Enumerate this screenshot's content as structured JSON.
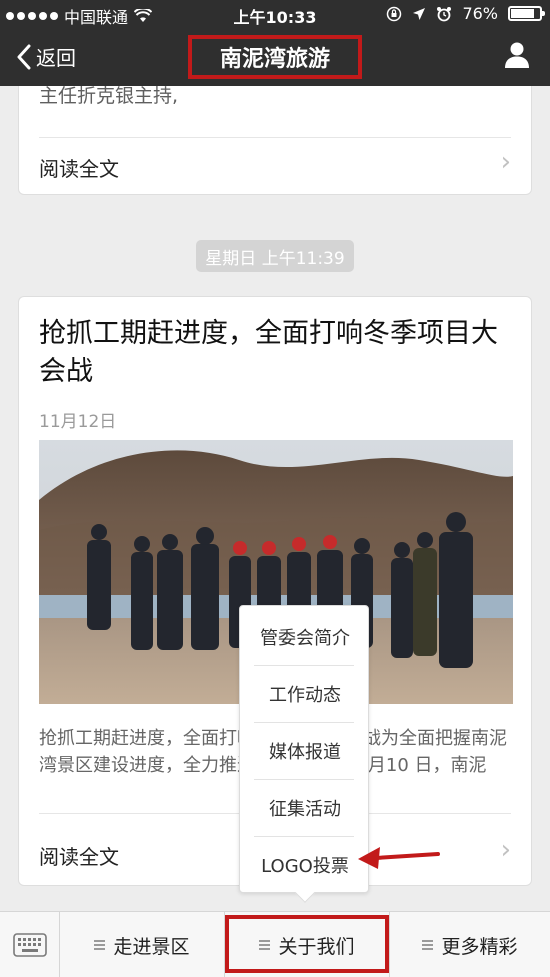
{
  "status_bar": {
    "carrier": "中国联通",
    "time": "上午10:33",
    "battery": "76%",
    "battery_level": 0.76
  },
  "nav": {
    "back_label": "返回",
    "title": "南泥湾旅游",
    "profile_icon": "person-icon"
  },
  "feed": {
    "card1": {
      "text": "主任折克银主持,",
      "read_more": "阅读全文"
    },
    "timestamp": "星期日 上午11:39",
    "card2": {
      "title": "抢抓工期赶进度，全面打响冬季项目大会战",
      "date": "11月12日",
      "excerpt": "抢抓工期赶进度，全面打响冬季项目大会战为全面把握南泥湾景区建设进度，全力推进项目建设，11月10 日，南泥",
      "read_more": "阅读全文"
    }
  },
  "popup_menu": {
    "items": [
      "管委会简介",
      "工作动态",
      "媒体报道",
      "征集活动",
      "LOGO投票"
    ]
  },
  "bottom_menu": {
    "keyboard_icon": "keyboard-icon",
    "tabs": [
      "走进景区",
      "关于我们",
      "更多精彩"
    ]
  },
  "colors": {
    "highlight": "#c21a1a",
    "header_bg": "#2f2f2f"
  }
}
